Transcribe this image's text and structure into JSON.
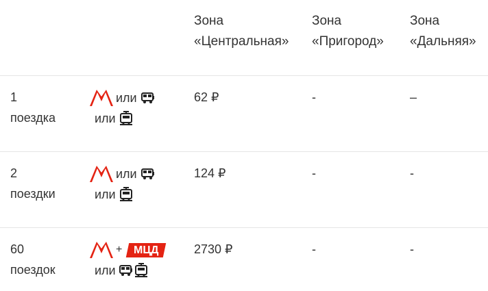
{
  "header": {
    "zones": [
      {
        "line1": "Зона",
        "line2": "«Центральная»"
      },
      {
        "line1": "Зона",
        "line2": "«Пригород»"
      },
      {
        "line1": "Зона",
        "line2": "«Дальняя»"
      }
    ]
  },
  "rows": [
    {
      "count": "1",
      "unit": "поездка",
      "or1": "или",
      "or2": "или",
      "central": "62 ₽",
      "suburb": "-",
      "far": "–"
    },
    {
      "count": "2",
      "unit": "поездки",
      "or1": "или",
      "or2": "или",
      "central": "124 ₽",
      "suburb": "-",
      "far": "-"
    },
    {
      "count": "60",
      "unit": "поездок",
      "plus": "+",
      "mcd": "МЦД",
      "or2": "или",
      "central": "2730 ₽",
      "suburb": "-",
      "far": "-"
    }
  ],
  "icons": [
    "metro-logo-icon",
    "bus-icon",
    "tram-icon",
    "mcd-badge"
  ],
  "colors": {
    "metro_red": "#e42313",
    "text": "#333333",
    "divider": "#e4e4e4"
  }
}
